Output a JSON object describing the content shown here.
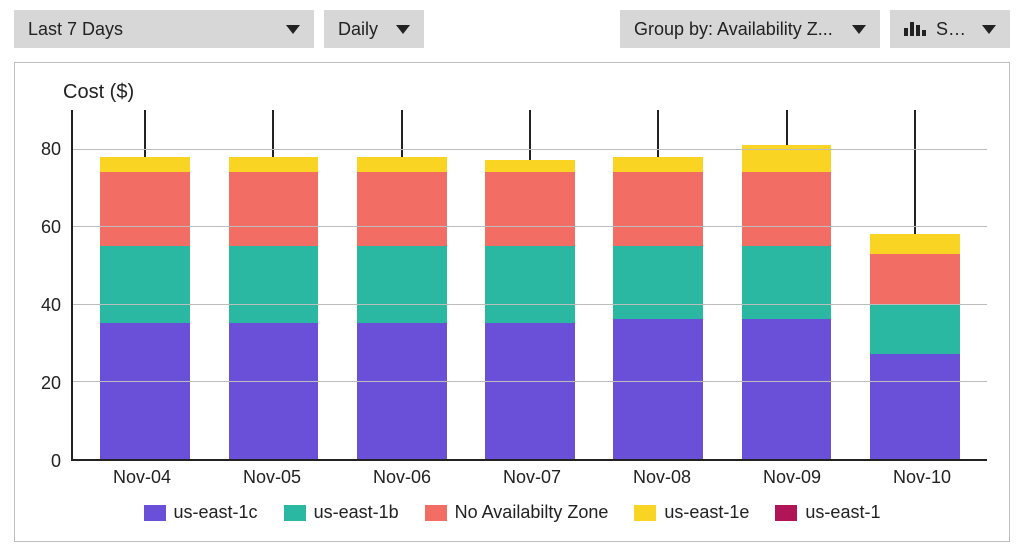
{
  "toolbar": {
    "range": "Last 7 Days",
    "granularity": "Daily",
    "group_by": "Group by: Availability Z...",
    "display": "Stack"
  },
  "chart_data": {
    "type": "bar",
    "stacked": true,
    "title": "Cost ($)",
    "ylabel": "Cost ($)",
    "ylim": [
      0,
      90
    ],
    "yticks": [
      0,
      20,
      40,
      60,
      80
    ],
    "categories": [
      "Nov-04",
      "Nov-05",
      "Nov-06",
      "Nov-07",
      "Nov-08",
      "Nov-09",
      "Nov-10"
    ],
    "series": [
      {
        "name": "us-east-1c",
        "color": "#6a4fd8",
        "values": [
          35,
          35,
          35,
          35,
          36,
          36,
          27
        ]
      },
      {
        "name": "us-east-1b",
        "color": "#2bb8a3",
        "values": [
          20,
          20,
          20,
          20,
          19,
          19,
          13
        ]
      },
      {
        "name": "No Availabilty Zone",
        "color": "#f26d63",
        "values": [
          19,
          19,
          19,
          19,
          19,
          19,
          13
        ]
      },
      {
        "name": "us-east-1e",
        "color": "#f9d423",
        "values": [
          4,
          4,
          4,
          3,
          4,
          7,
          5
        ]
      },
      {
        "name": "us-east-1",
        "color": "#b01657",
        "values": [
          0,
          0,
          0,
          0,
          0,
          0,
          0
        ]
      }
    ],
    "error_top": 90
  }
}
